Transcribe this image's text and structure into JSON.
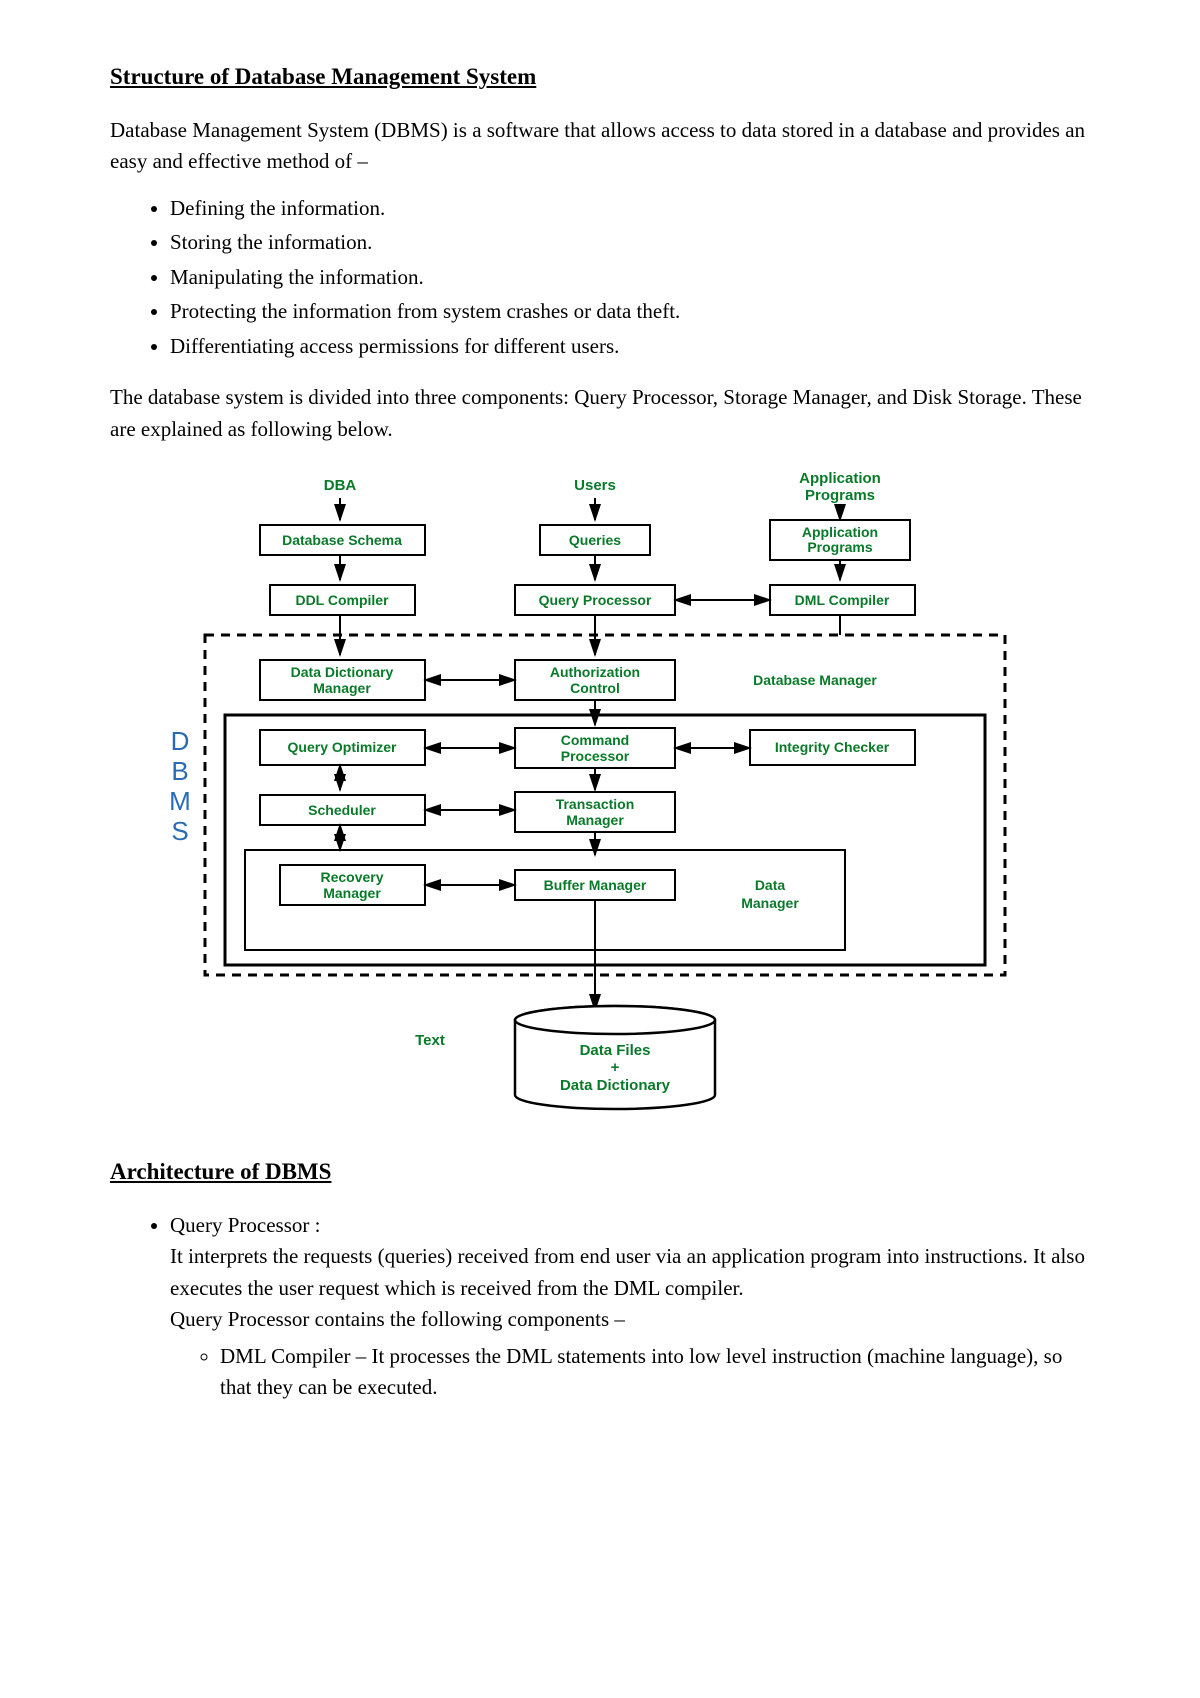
{
  "title": "Structure of Database Management System",
  "intro": "Database Management System (DBMS) is a software that allows access to data stored in a database and provides an easy and effective method of –",
  "bullets": [
    "Defining the information.",
    "Storing the information.",
    "Manipulating the information.",
    "Protecting the information from system crashes or data theft.",
    "Differentiating access permissions for different users."
  ],
  "para2": "The database system is divided into three components: Query Processor, Storage Manager, and Disk Storage. These are explained as following below.",
  "diagram": {
    "topLabels": {
      "dba": "DBA",
      "users": "Users",
      "appprog": "Application\nPrograms"
    },
    "row1": {
      "schema": "Database Schema",
      "queries": "Queries",
      "appprog2": "Application\nPrograms"
    },
    "row2": {
      "ddl": "DDL Compiler",
      "qp": "Query Processor",
      "dml": "DML Compiler"
    },
    "row3": {
      "ddm": "Data Dictionary\nManager",
      "auth": "Authorization\nControl",
      "dbmgr": "Database Manager"
    },
    "row4": {
      "qo": "Query Optimizer",
      "cp": "Command\nProcessor",
      "ic": "Integrity Checker"
    },
    "row5": {
      "sched": "Scheduler",
      "tm": "Transaction\nManager"
    },
    "row6": {
      "rm": "Recovery\nManager",
      "bm": "Buffer Manager",
      "dmgr": "Data\nManager"
    },
    "side": "DBMS",
    "textLabel": "Text",
    "cyl1": "Data Files",
    "cylplus": "+",
    "cyl2": "Data Dictionary"
  },
  "subtitle": "Architecture of DBMS",
  "qp": {
    "heading": "Query Processor :",
    "body1": "It interprets the requests (queries) received from end user via an application program into instructions. It also executes the user request which is received from the DML compiler.",
    "body2": "Query Processor contains the following components –",
    "sub": "DML Compiler – It processes the DML statements into low level instruction (machine language), so that they can be executed."
  }
}
